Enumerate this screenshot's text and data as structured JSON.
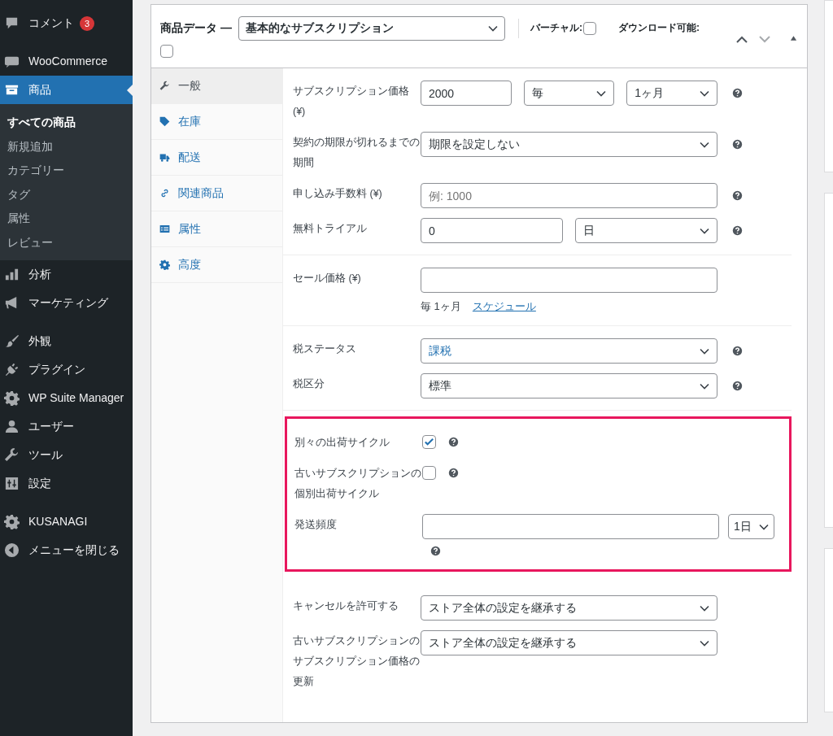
{
  "sidebar": {
    "groups": [
      [
        {
          "label": "コメント",
          "badge": "3",
          "selected": false
        }
      ],
      [
        {
          "label": "WooCommerce",
          "selected": false
        },
        {
          "label": "商品",
          "selected": true,
          "children": [
            {
              "label": "すべての商品",
              "selected": true
            },
            {
              "label": "新規追加",
              "selected": false
            },
            {
              "label": "カテゴリー",
              "selected": false
            },
            {
              "label": "タグ",
              "selected": false
            },
            {
              "label": "属性",
              "selected": false
            },
            {
              "label": "レビュー",
              "selected": false
            }
          ]
        },
        {
          "label": "分析",
          "selected": false
        },
        {
          "label": "マーケティング",
          "selected": false
        }
      ],
      [
        {
          "label": "外観",
          "selected": false
        },
        {
          "label": "プラグイン",
          "selected": false
        },
        {
          "label": "WP Suite Manager",
          "selected": false
        },
        {
          "label": "ユーザー",
          "selected": false
        },
        {
          "label": "ツール",
          "selected": false
        },
        {
          "label": "設定",
          "selected": false
        }
      ],
      [
        {
          "label": "KUSANAGI",
          "selected": false
        },
        {
          "label": "メニューを閉じる",
          "selected": false
        }
      ]
    ]
  },
  "panel": {
    "title": "商品データ —",
    "product_type": "基本的なサブスクリプション",
    "options": [
      {
        "label": "バーチャル:",
        "checked": false
      },
      {
        "label": "ダウンロード可能:",
        "checked": false
      }
    ],
    "tabs": [
      {
        "label": "一般",
        "selected": true
      },
      {
        "label": "在庫",
        "selected": false
      },
      {
        "label": "配送",
        "selected": false
      },
      {
        "label": "関連商品",
        "selected": false
      },
      {
        "label": "属性",
        "selected": false
      },
      {
        "label": "高度",
        "selected": false
      }
    ],
    "sections": [
      {
        "highlighted": false,
        "rows": [
          {
            "kind": "fields",
            "label": "サブスクリプション価格 (¥)",
            "help": true,
            "controls": [
              {
                "kind": "input",
                "value": "2000"
              },
              {
                "kind": "select",
                "value": "毎"
              },
              {
                "kind": "select",
                "value": "1ヶ月"
              }
            ]
          },
          {
            "kind": "fields",
            "label": "契約の期限が切れるまでの期間",
            "help": true,
            "controls": [
              {
                "kind": "select",
                "value": "期限を設定しない"
              }
            ]
          },
          {
            "kind": "fields",
            "label": "申し込み手数料 (¥)",
            "help": true,
            "controls": [
              {
                "kind": "input",
                "placeholder": "例: 1000"
              }
            ]
          },
          {
            "kind": "fields",
            "label": "無料トライアル",
            "help": true,
            "controls": [
              {
                "kind": "input",
                "value": "0"
              },
              {
                "kind": "select",
                "value": "日"
              }
            ]
          }
        ]
      },
      {
        "highlighted": false,
        "rows": [
          {
            "kind": "fields",
            "label": "セール価格 (¥)",
            "help": false,
            "controls": [
              {
                "kind": "input"
              }
            ],
            "note": "毎 1ヶ月",
            "link": "スケジュール"
          }
        ]
      },
      {
        "highlighted": false,
        "rows": [
          {
            "kind": "fields",
            "label": "税ステータス",
            "help": true,
            "controls": [
              {
                "kind": "select",
                "value": "課税",
                "accent": true
              }
            ]
          },
          {
            "kind": "fields",
            "label": "税区分",
            "help": true,
            "controls": [
              {
                "kind": "select",
                "value": "標準"
              }
            ]
          }
        ]
      },
      {
        "highlighted": true,
        "rows": [
          {
            "kind": "checkbox",
            "label": "別々の出荷サイクル",
            "help": true,
            "checked": true
          },
          {
            "kind": "checkbox",
            "label": "古いサブスクリプションの個別出荷サイクル",
            "help": true,
            "checked": false
          },
          {
            "kind": "frequency",
            "label": "発送頻度",
            "help": true,
            "controls": [
              {
                "kind": "input"
              },
              {
                "kind": "select",
                "value": "1日"
              }
            ]
          }
        ]
      },
      {
        "highlighted": false,
        "rows": [
          {
            "kind": "fields",
            "label": "キャンセルを許可する",
            "help": false,
            "controls": [
              {
                "kind": "select",
                "value": "ストア全体の設定を継承する"
              }
            ]
          },
          {
            "kind": "fields",
            "label": "古いサブスクリプションのサブスクリプション価格の更新",
            "help": false,
            "controls": [
              {
                "kind": "select",
                "value": "ストア全体の設定を継承する"
              }
            ]
          }
        ]
      }
    ]
  }
}
